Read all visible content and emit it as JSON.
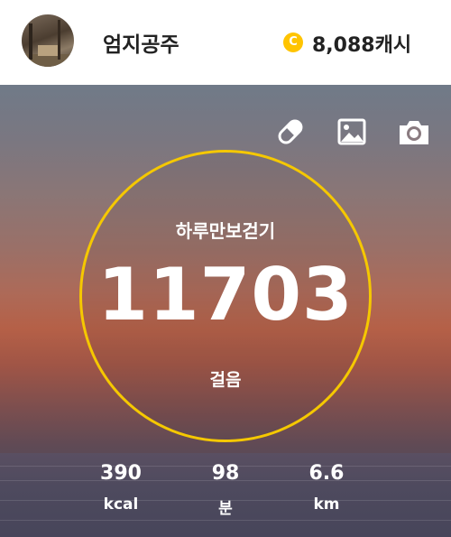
{
  "profile": {
    "name": "엄지공주"
  },
  "cash": {
    "coin_symbol": "C",
    "amount": "8,088캐시"
  },
  "toolbar": {
    "icons": [
      "pill-icon",
      "gallery-icon",
      "camera-icon"
    ]
  },
  "pedometer": {
    "label": "하루만보걷기",
    "steps": "11703",
    "unit": "걸음",
    "ring_color": "#f5c800"
  },
  "stats": [
    {
      "value": "390",
      "unit": "kcal"
    },
    {
      "value": "98",
      "unit": "분"
    },
    {
      "value": "6.6",
      "unit": "km"
    }
  ],
  "colors": {
    "coin": "#ffc400",
    "text_dark": "#222222"
  }
}
